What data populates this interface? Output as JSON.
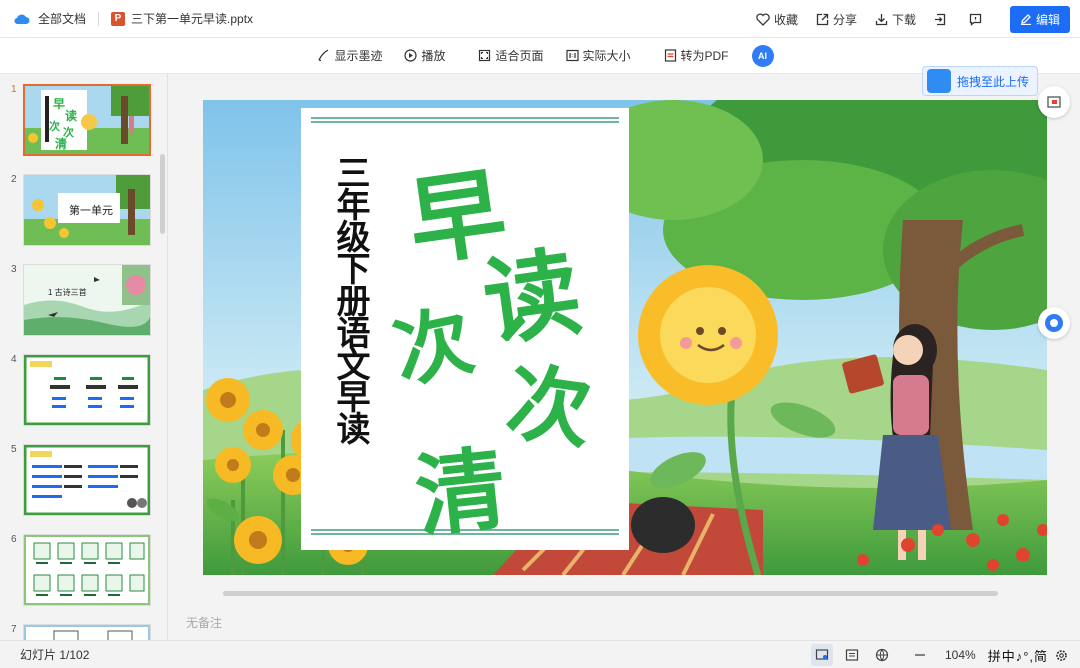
{
  "topbar": {
    "all_docs": "全部文档",
    "file_name": "三下第一单元早读.pptx",
    "badge": "P",
    "favorite": "收藏",
    "share": "分享",
    "download": "下载",
    "edit": "编辑"
  },
  "toolbar": {
    "show_ink": "显示墨迹",
    "play": "播放",
    "fit_page": "适合页面",
    "actual_size": "实际大小",
    "to_pdf": "转为PDF",
    "ai": "AI"
  },
  "thumbnails": [
    {
      "num": "1",
      "label": ""
    },
    {
      "num": "2",
      "label": "第一单元"
    },
    {
      "num": "3",
      "label": "1 古诗三首"
    },
    {
      "num": "4",
      "label": ""
    },
    {
      "num": "5",
      "label": ""
    },
    {
      "num": "6",
      "label": ""
    },
    {
      "num": "7",
      "label": ""
    }
  ],
  "slide": {
    "vertical_title": "三年级下册语文早读",
    "title_chars": [
      "早",
      "读",
      "次",
      "次",
      "清"
    ]
  },
  "upload_button": "拖拽至此上传",
  "notes_placeholder": "无备注",
  "status": {
    "slide_count": "幻灯片 1/102",
    "zoom": "104%",
    "ime": "拼中♪°,简"
  },
  "colors": {
    "accent": "#1d6cf5",
    "title_green": "#2db24a",
    "active_thumb_border": "#e36b2f"
  }
}
